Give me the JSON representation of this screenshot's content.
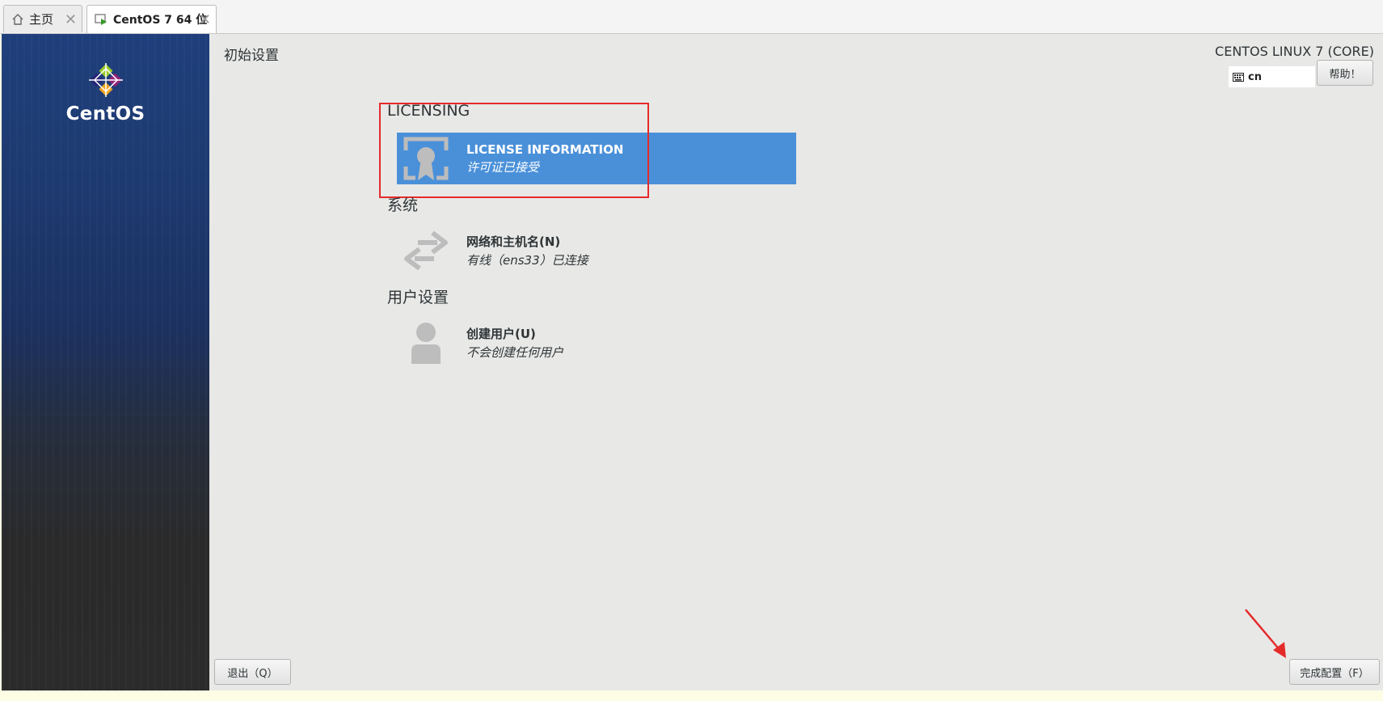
{
  "tabs": [
    {
      "label": "主页",
      "icon": "home-icon"
    },
    {
      "label": "CentOS 7 64 位",
      "icon": "vm-icon"
    }
  ],
  "sidebar": {
    "logo_text": "CentOS"
  },
  "header": {
    "title": "初始设置",
    "product": "CENTOS LINUX 7 (CORE)",
    "keyboard_layout": "cn",
    "help_label": "帮助！"
  },
  "sections": [
    {
      "title": "LICENSING",
      "spokes": [
        {
          "title": "LICENSE INFORMATION",
          "status": "许可证已接受",
          "icon": "license-icon",
          "selected": true
        }
      ]
    },
    {
      "title": "系统",
      "spokes": [
        {
          "title": "网络和主机名(N)",
          "status": "有线（ens33）已连接",
          "icon": "network-icon"
        }
      ]
    },
    {
      "title": "用户设置",
      "spokes": [
        {
          "title": "创建用户(U)",
          "status": "不会创建任何用户",
          "icon": "user-icon"
        }
      ]
    }
  ],
  "footer": {
    "quit_label": "退出（Q）",
    "finish_label": "完成配置（F）"
  },
  "colors": {
    "selected": "#4a90d9",
    "annotation": "#e52a2a",
    "sidebar_top": "#1f3f7c",
    "main_bg": "#e8e8e7"
  }
}
